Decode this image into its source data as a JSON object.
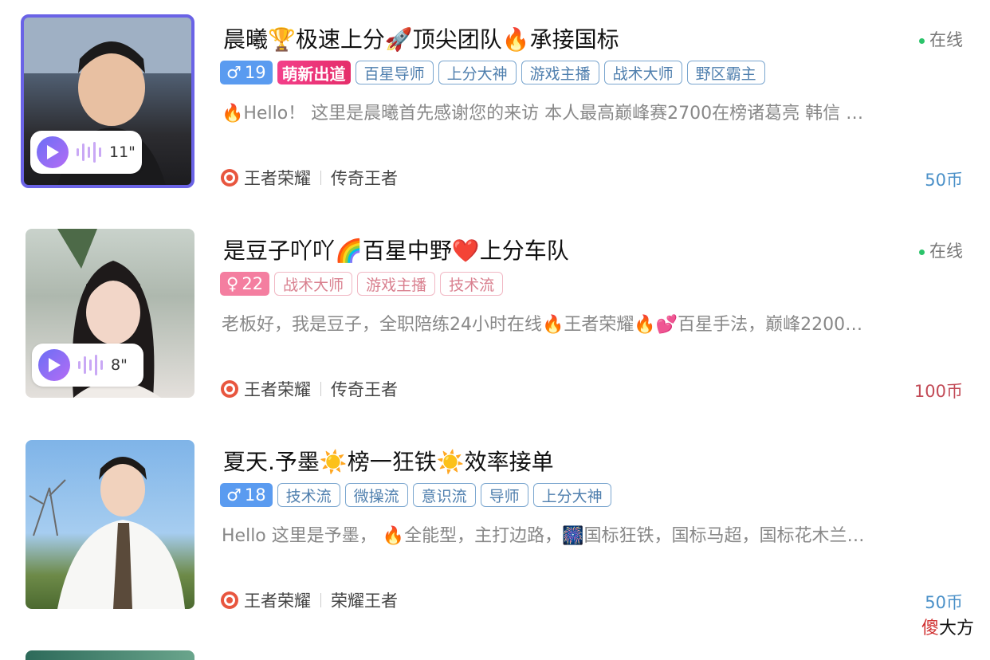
{
  "listings": [
    {
      "name": "晨曦🏆极速上分🚀顶尖团队🔥承接国标",
      "status": "在线",
      "gender": "♂",
      "age": "19",
      "badge": "萌新出道",
      "tags": [
        "百星导师",
        "上分大神",
        "游戏主播",
        "战术大师",
        "野区霸主"
      ],
      "description": "🔥Hello！ 这里是晨曦首先感谢您的来访 本人最高巅峰赛2700在榜诸葛亮 韩信 …",
      "voice_duration": "11\"",
      "game": "王者荣耀",
      "rank": "传奇王者",
      "price": "50币"
    },
    {
      "name": "是豆子吖吖🌈百星中野❤️上分车队",
      "status": "在线",
      "gender": "♀",
      "age": "22",
      "tags": [
        "战术大师",
        "游戏主播",
        "技术流"
      ],
      "description": "老板好，我是豆子，全职陪练24小时在线🔥王者荣耀🔥💕百星手法，巅峰2200…",
      "voice_duration": "8\"",
      "game": "王者荣耀",
      "rank": "传奇王者",
      "price": "100币"
    },
    {
      "name": "夏天.予墨☀️榜一狂铁☀️效率接单",
      "gender": "♂",
      "age": "18",
      "tags": [
        "技术流",
        "微操流",
        "意识流",
        "导师",
        "上分大神"
      ],
      "description": "Hello 这里是予墨， 🔥全能型，主打边路，🎆国标狂铁，国标马超，国标花木兰…",
      "game": "王者荣耀",
      "rank": "荣耀王者",
      "price": "50币"
    }
  ],
  "watermark": {
    "first": "傻",
    "rest": "大方"
  },
  "colors": {
    "online_dot": "#2bc36a",
    "tag_blue": "#4f7fae",
    "tag_pink": "#d9808f",
    "price_blue": "#4a90c8",
    "price_red": "#c24a56"
  }
}
